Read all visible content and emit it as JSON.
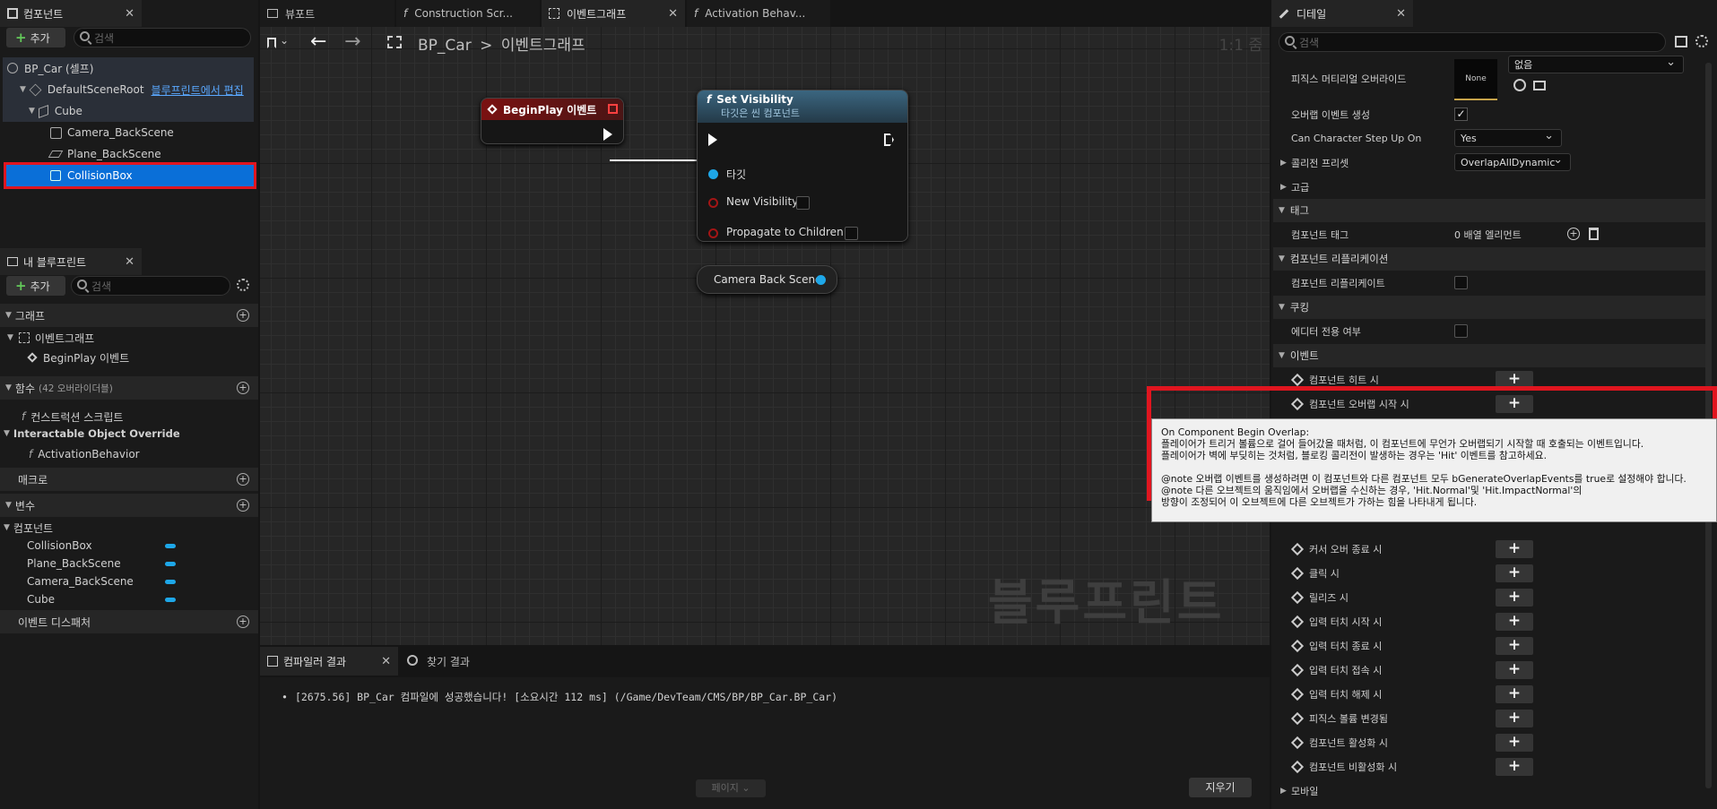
{
  "components_panel": {
    "tab_label": "컴포넌트",
    "add_label": "추가",
    "search_placeholder": "검색",
    "items": [
      {
        "label": "BP_Car (셀프)"
      },
      {
        "label": "DefaultSceneRoot",
        "link": "블루프린트에서 편집"
      },
      {
        "label": "Cube"
      },
      {
        "label": "Camera_BackScene"
      },
      {
        "label": "Plane_BackScene"
      },
      {
        "label": "CollisionBox"
      }
    ]
  },
  "my_blueprint": {
    "tab_label": "내 블루프린트",
    "add_label": "추가",
    "search_placeholder": "검색",
    "graph_section": "그래프",
    "event_graph": "이벤트그래프",
    "beginplay": "BeginPlay 이벤트",
    "functions_section": "함수",
    "functions_override": "(42 오버라이더블)",
    "construction_script": "컨스트럭션 스크립트",
    "interactable_override": "Interactable Object Override",
    "activation_behavior": "ActivationBehavior",
    "macros_section": "매크로",
    "variables_section": "변수",
    "components_group": "컴포넌트",
    "variables": [
      "CollisionBox",
      "Plane_BackScene",
      "Camera_BackScene",
      "Cube"
    ],
    "dispatchers_section": "이벤트 디스패처"
  },
  "center_tabs": [
    {
      "label": "뷰포트"
    },
    {
      "label": "Construction Scr..."
    },
    {
      "label": "이벤트그래프"
    },
    {
      "label": "Activation Behav..."
    }
  ],
  "graph": {
    "breadcrumb_bp": "BP_Car",
    "breadcrumb_sep": ">",
    "breadcrumb_graph": "이벤트그래프",
    "zoom": "1:1 줌",
    "watermark": "블루프린트",
    "node_beginplay": "BeginPlay 이벤트",
    "node_setvis_title": "Set Visibility",
    "node_setvis_sub": "타깃은 씬 컴포넌트",
    "pin_target": "타깃",
    "pin_new_visibility": "New Visibility",
    "pin_propagate": "Propagate to Children",
    "node_camera": "Camera Back Scene"
  },
  "compiler": {
    "tab_label": "컴파일러 결과",
    "find_label": "찾기 결과",
    "log_line": "[2675.56] BP_Car 컴파일에 성공했습니다! [소요시간 112 ms] (/Game/DevTeam/CMS/BP/BP_Car.BP_Car)",
    "page_label": "페이지",
    "clear_label": "지우기"
  },
  "details": {
    "tab_label": "디테일",
    "search_placeholder": "검색",
    "phys_mat_label": "피직스 머티리얼 오버라이드",
    "phys_mat_thumb": "None",
    "phys_mat_combo": "없음",
    "overlap_label": "오버랩 이벤트 생성",
    "step_up_label": "Can Character Step Up On",
    "step_up_value": "Yes",
    "collision_preset_label": "콜리전 프리셋",
    "collision_preset_value": "OverlapAllDynamic",
    "advanced_section": "고급",
    "tags_section": "태그",
    "component_tags_label": "컴포넌트 태그",
    "component_tags_value": "0 배열 엘리먼트",
    "replication_section": "컴포넌트 리플리케이션",
    "replicates_label": "컴포넌트 리플리케이트",
    "cooking_section": "쿠킹",
    "editor_only_label": "에디터 전용 여부",
    "events_section": "이벤트",
    "events": [
      "컴포넌트 히트 시",
      "컴포넌트 오버랩 시작 시"
    ],
    "events_lower": [
      "커서 오버 종료 시",
      "클릭 시",
      "릴리즈 시",
      "입력 터치 시작 시",
      "입력 터치 종료 시",
      "입력 터치 접속 시",
      "입력 터치 해제 시",
      "피직스 볼륨 변경됨",
      "컴포넌트 활성화 시",
      "컴포넌트 비활성화 시"
    ],
    "mobile_section": "모바일"
  },
  "tooltip": {
    "title": "On Component Begin Overlap:",
    "line1": "플레이어가 트리거 볼륨으로 걸어 들어갔을 때처럼, 이 컴포넌트에 무언가 오버랩되기 시작할 때 호출되는 이벤트입니다.",
    "line2": "플레이어가 벽에 부딪히는 것처럼, 블로킹 콜리전이 발생하는 경우는 'Hit' 이벤트를 참고하세요.",
    "line3": "@note 오버랩 이벤트를 생성하려면 이 컴포넌트와 다른 컴포넌트 모두 bGenerateOverlapEvents를 true로 설정해야 합니다.",
    "line4": "@note 다른 오브젝트의 움직임에서 오버랩을 수신하는 경우, 'Hit.Normal'및 'Hit.ImpactNormal'의",
    "line5": "방향이 조정되어 이 오브젝트에 다른 오브젝트가 가하는 힘을 나타내게 됩니다."
  },
  "colors": {
    "selection_blue": "#0a6fd8",
    "highlight_red": "#e0151f",
    "pin_blue": "#1ea7e8",
    "beginplay_header": "#7a1212"
  }
}
